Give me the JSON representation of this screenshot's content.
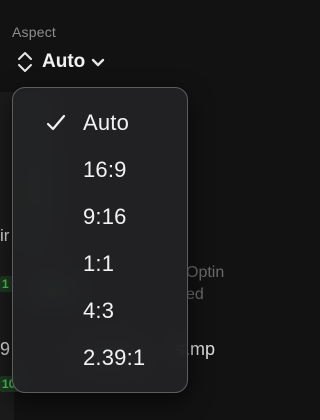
{
  "aspect": {
    "label": "Aspect",
    "selected": "Auto",
    "updown_icon": "chevron-up-down-icon",
    "dropdown_icon": "chevron-down-icon"
  },
  "menu": {
    "check_icon": "checkmark-icon",
    "items": [
      {
        "label": "Auto",
        "selected": true
      },
      {
        "label": "16:9",
        "selected": false
      },
      {
        "label": "9:16",
        "selected": false
      },
      {
        "label": "1:1",
        "selected": false
      },
      {
        "label": "4:3",
        "selected": false
      },
      {
        "label": "2.39:1",
        "selected": false
      }
    ]
  },
  "background": {
    "badge_1": "1",
    "badge_2": "10",
    "clip_text": "9",
    "file_text": "s.mp",
    "option_text_line1": "Optin",
    "option_text_line2": "ed",
    "partial_text": "ir"
  },
  "colors": {
    "menu_background": "#242426",
    "menu_border": "#5c5c60",
    "badge_green": "#4ec45b",
    "text_primary": "#f2f2f2",
    "text_secondary": "#8e8e8e"
  }
}
